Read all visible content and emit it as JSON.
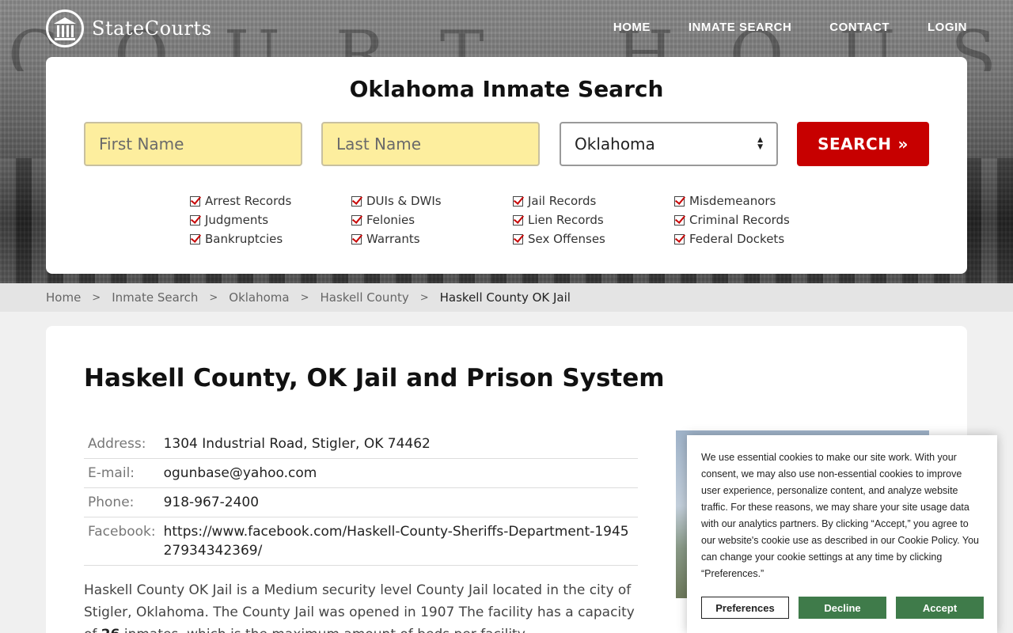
{
  "header": {
    "logo_text": "StateCourts",
    "nav": [
      "HOME",
      "INMATE SEARCH",
      "CONTACT",
      "LOGIN"
    ]
  },
  "hero": {
    "background_text": "COURT HOUSE"
  },
  "search": {
    "title": "Oklahoma Inmate Search",
    "first_name_placeholder": "First Name",
    "last_name_placeholder": "Last Name",
    "state_selected": "Oklahoma",
    "button_label": "SEARCH",
    "record_types": [
      "Arrest Records",
      "DUIs & DWIs",
      "Jail Records",
      "Misdemeanors",
      "Judgments",
      "Felonies",
      "Lien Records",
      "Criminal Records",
      "Bankruptcies",
      "Warrants",
      "Sex Offenses",
      "Federal Dockets"
    ]
  },
  "breadcrumb": [
    "Home",
    "Inmate Search",
    "Oklahoma",
    "Haskell County",
    "Haskell County OK Jail"
  ],
  "main": {
    "title": "Haskell County, OK Jail and Prison System",
    "info": [
      {
        "label": "Address:",
        "value": "1304 Industrial Road, Stigler, OK 74462"
      },
      {
        "label": "E-mail:",
        "value": "ogunbase@yahoo.com"
      },
      {
        "label": "Phone:",
        "value": "918-967-2400"
      },
      {
        "label": "Facebook:",
        "value": "https://www.facebook.com/Haskell-County-Sheriffs-Department-194527934342369/"
      }
    ],
    "description_before": "Haskell County OK Jail is a Medium security level County Jail located in the city of Stigler, Oklahoma. The County Jail was opened in 1907 The facility has a capacity of ",
    "capacity": "26",
    "description_after": " inmates, which is the maximum amount of beds per facility."
  },
  "cookie": {
    "text_1": "We use essential cookies to make our site work. With your consent, we may also use non-essential cookies to improve user experience, personalize content, and analyze website traffic. For these reasons, we may share your site usage data with our analytics partners. By clicking “Accept,” you agree to our website's cookie use as described in our ",
    "policy_link": "Cookie Policy",
    "text_2": ". You can change your cookie settings at any time by clicking “",
    "preferences_link": "Preferences",
    "text_3": ".”",
    "buttons": {
      "preferences": "Preferences",
      "decline": "Decline",
      "accept": "Accept"
    }
  },
  "colors": {
    "accent_red": "#c70000",
    "input_yellow": "#fdee9e",
    "cookie_green": "#3f7b4a"
  }
}
